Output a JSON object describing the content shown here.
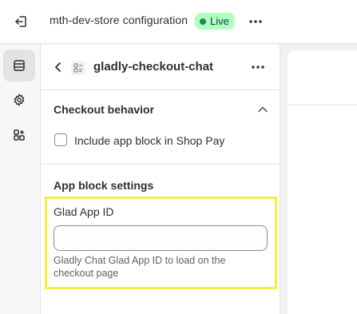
{
  "topbar": {
    "title": "mth-dev-store configuration",
    "status_badge": "Live",
    "icons": {
      "exit": "exit-icon",
      "more": "more-horizontal-icon"
    }
  },
  "rail": {
    "items": [
      {
        "name": "sections",
        "icon": "sections-icon",
        "active": true
      },
      {
        "name": "settings",
        "icon": "gear-icon",
        "active": false
      },
      {
        "name": "apps",
        "icon": "apps-icon",
        "active": false
      }
    ]
  },
  "panel": {
    "title": "gladly-checkout-chat",
    "sections": {
      "checkout_behavior": {
        "heading": "Checkout behavior",
        "checkbox_label": "Include app block in Shop Pay",
        "checked": false
      },
      "app_block_settings": {
        "heading": "App block settings",
        "field_label": "Glad App ID",
        "field_value": "",
        "help_text": "Gladly Chat Glad App ID to load on the checkout page"
      }
    }
  },
  "colors": {
    "badge_bg": "#affebf",
    "badge_text": "#014b40",
    "badge_dot": "#29845a",
    "highlight": "#f2f040"
  }
}
